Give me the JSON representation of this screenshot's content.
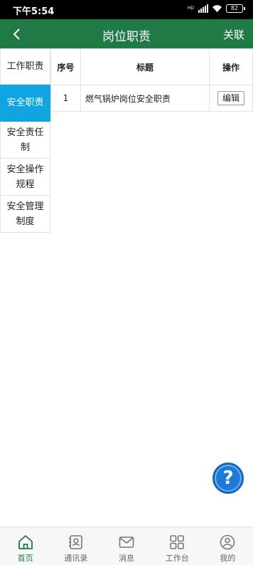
{
  "status": {
    "time": "下午5:54",
    "network": "HD",
    "battery": "82"
  },
  "header": {
    "title": "岗位职责",
    "action": "关联",
    "bg": "#1f7a45"
  },
  "leftmenu": {
    "header": "工作职责",
    "items": [
      {
        "label": "安全职责",
        "active": true
      },
      {
        "label": "安全责任制",
        "active": false
      },
      {
        "label": "安全操作规程",
        "active": false
      },
      {
        "label": "安全管理制度",
        "active": false
      }
    ],
    "active_color": "#10a4e0"
  },
  "table": {
    "columns": [
      "序号",
      "标题",
      "操作"
    ],
    "rows": [
      {
        "index": "1",
        "title": "燃气锅炉岗位安全职责",
        "action": "编辑"
      }
    ]
  },
  "help": {
    "glyph": "?"
  },
  "bottomnav": {
    "items": [
      {
        "label": "首页",
        "icon": "home-icon",
        "active": true
      },
      {
        "label": "通讯录",
        "icon": "contacts-icon",
        "active": false
      },
      {
        "label": "消息",
        "icon": "mail-icon",
        "active": false
      },
      {
        "label": "工作台",
        "icon": "grid-icon",
        "active": false
      },
      {
        "label": "我的",
        "icon": "user-icon",
        "active": false
      }
    ]
  }
}
